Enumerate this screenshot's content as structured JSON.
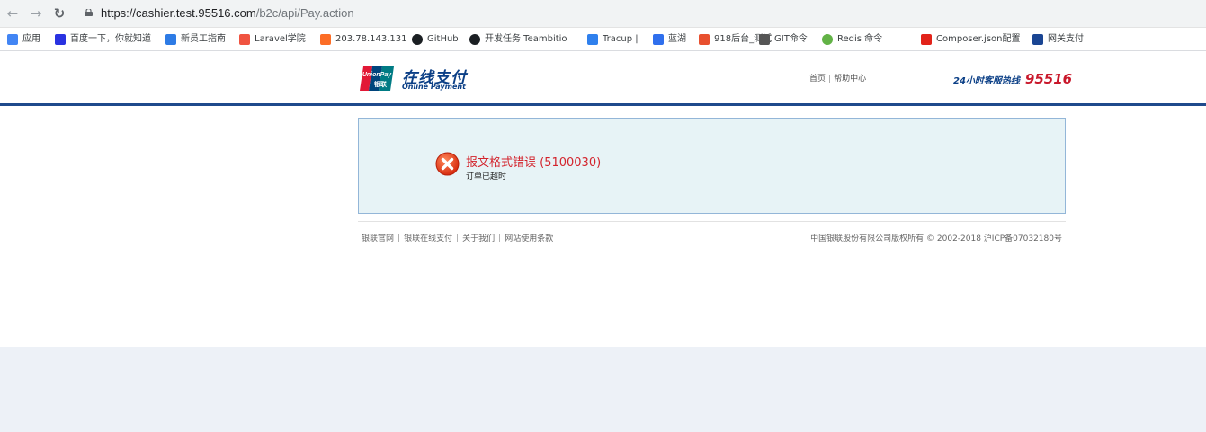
{
  "browser": {
    "url_host": "https://cashier.test.95516.com",
    "url_path": "/b2c/api/Pay.action",
    "bookmarks": [
      {
        "label": "应用",
        "icon": "apps-grid-icon",
        "color": "#4285f4"
      },
      {
        "label": "百度一下，你就知道",
        "icon": "baidu-paw-icon",
        "color": "#2932e1"
      },
      {
        "label": "新员工指南",
        "icon": "doc-icon",
        "color": "#2d7be5"
      },
      {
        "label": "Laravel学院",
        "icon": "laravel-icon",
        "color": "#f05340"
      },
      {
        "label": "203.78.143.131",
        "icon": "gitlab-fox-icon",
        "color": "#fc6d26"
      },
      {
        "label": "GitHub",
        "icon": "github-icon",
        "color": "#1b1f23"
      },
      {
        "label": "开发任务 Teambitio",
        "icon": "teambition-icon",
        "color": "#1b1f23"
      },
      {
        "label": "Tracup |",
        "icon": "tracup-icon",
        "color": "#2f80ed"
      },
      {
        "label": "蓝湖",
        "icon": "lanhu-icon",
        "color": "#2f6fed"
      },
      {
        "label": "918后台_测试",
        "icon": "tab-icon",
        "color": "#e8502f"
      },
      {
        "label": "GIT命令",
        "icon": "git-script-icon",
        "color": "#555555"
      },
      {
        "label": "Redis 命令",
        "icon": "redis-icon",
        "color": "#62b246"
      },
      {
        "label": "Composer.json配置",
        "icon": "composer-c-icon",
        "color": "#e2231a"
      },
      {
        "label": "网关支付",
        "icon": "unionpay-card-icon",
        "color": "#1a4593"
      }
    ]
  },
  "header": {
    "logo_badge_top": "UnionPay",
    "logo_badge_bottom": "银联",
    "logo_cn": "在线支付",
    "logo_en": "Online Payment",
    "nav_home": "首页",
    "nav_sep": "|",
    "nav_help": "帮助中心",
    "hotline_label": "24小时客服热线",
    "hotline_number": "95516"
  },
  "error": {
    "title": "报文格式错误 (5100030)",
    "message": "订单已超时"
  },
  "footer": {
    "links": [
      "银联官网",
      "银联在线支付",
      "关于我们",
      "网站使用条款"
    ],
    "sep": "|",
    "copyright": "中国银联股份有限公司版权所有 © 2002-2018  沪ICP备07032180号"
  },
  "colors": {
    "brand_blue": "#0b3f86",
    "header_rule": "#1f4a8c",
    "error_red": "#d3232c",
    "error_box_bg": "#e7f3f6",
    "bottom_band": "#edf1f7"
  }
}
